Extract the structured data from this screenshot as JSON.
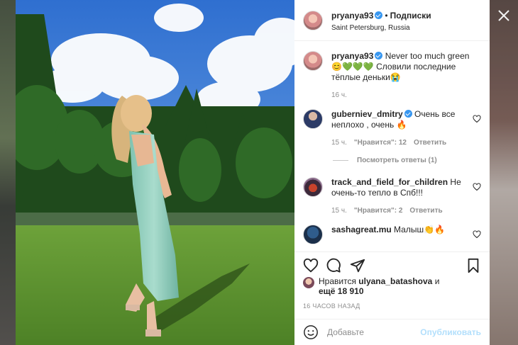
{
  "post": {
    "username": "pryanya93",
    "separator": "•",
    "follow_label": "Подписки",
    "location": "Saint Petersburg, Russia"
  },
  "caption": {
    "username": "pryanya93",
    "text": "Never too much green 😊💚💚💚 Словили последние тёплые деньки😭",
    "time": "16 ч."
  },
  "comments": [
    {
      "username": "guberniev_dmitry",
      "text": "Очень все неплохо , очень 🔥",
      "time": "15 ч.",
      "likes": "\"Нравится\": 12",
      "reply_label": "Ответить"
    },
    {
      "username": "track_and_field_for_children",
      "text": "Не очень-то тепло в Спб!!!",
      "time": "15 ч.",
      "likes": "\"Нравится\": 2",
      "reply_label": "Ответить"
    },
    {
      "username": "sashagreat.mu",
      "text": "Малыш👏🔥"
    }
  ],
  "view_replies": "Посмотреть ответы (1)",
  "liked_by": {
    "prefix": "Нравится",
    "user": "ulyana_batashova",
    "mid": "и",
    "others": "ещё 18 910"
  },
  "timestamp": "16 ЧАСОВ НАЗАД",
  "add_comment": {
    "placeholder": "Добавьте",
    "publish_label": "Опубликовать"
  },
  "icons": {
    "like": "heart-icon",
    "comment": "comment-icon",
    "share": "share-icon",
    "save": "bookmark-icon",
    "emoji": "emoji-icon",
    "close": "close-icon"
  },
  "colors": {
    "verified": "#3897f0",
    "link_disabled": "#b2dffc",
    "muted": "#8e8e8e",
    "text": "#262626"
  }
}
